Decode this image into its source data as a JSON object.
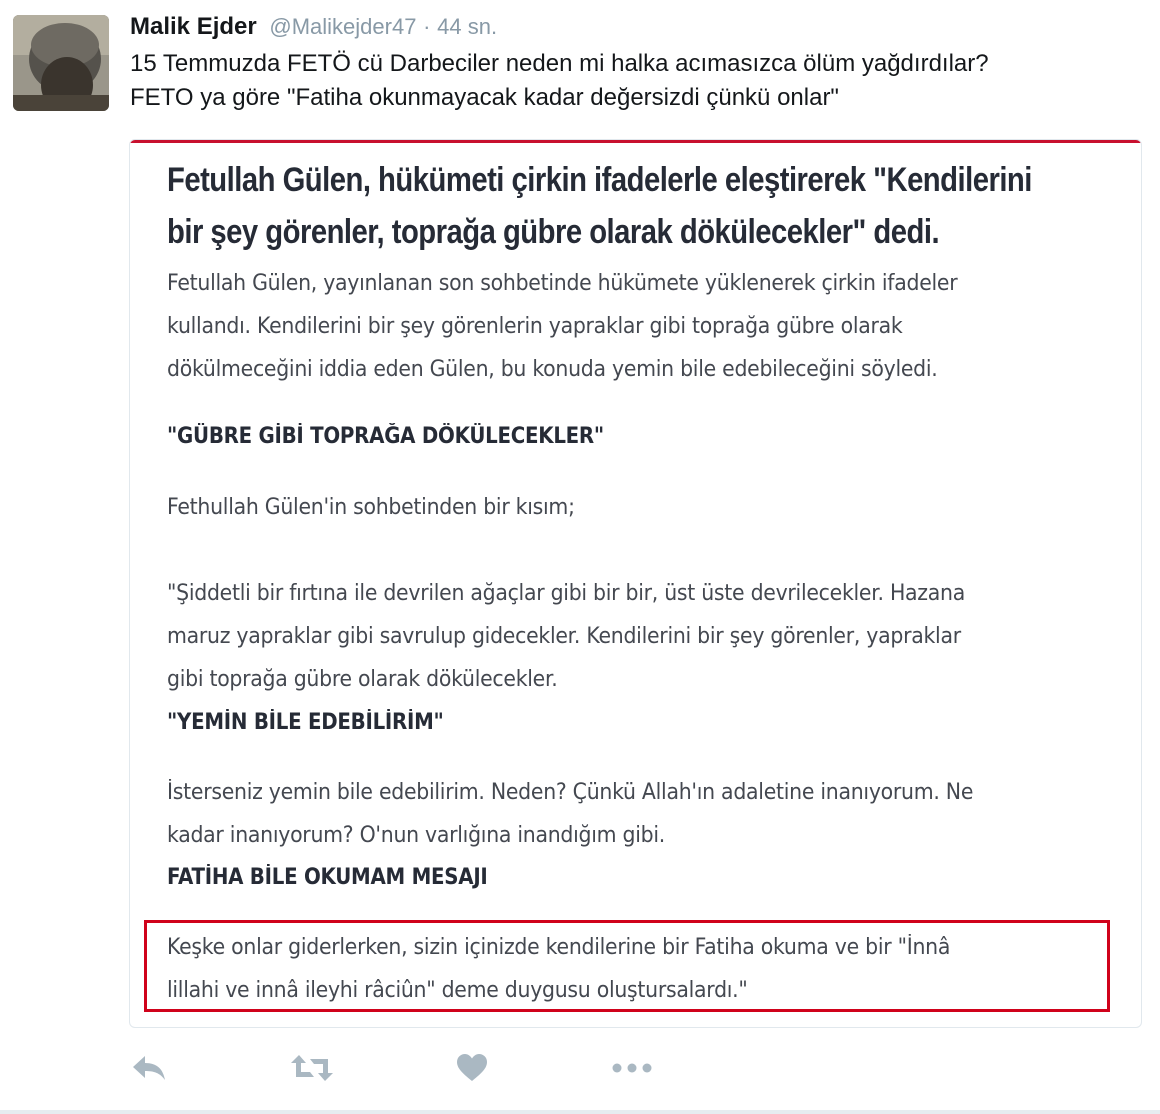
{
  "tweet": {
    "author_name": "Malik Ejder",
    "author_handle": "@Malikejder47",
    "separator": "·",
    "timestamp": "44 sn.",
    "text_lines": [
      "15 Temmuzda FETÖ cü Darbeciler neden mi halka acımasızca ölüm yağdırdılar?",
      "FETO ya göre \"Fatiha okunmayacak kadar değersizdi çünkü onlar\""
    ]
  },
  "article": {
    "headline_lines": [
      "Fetullah Gülen, hükümeti çirkin ifadelerle eleştirerek \"Kendilerini",
      "bir şey görenler, toprağa gübre olarak dökülecekler\" dedi."
    ],
    "intro_lines": [
      "Fetullah Gülen, yayınlanan son sohbetinde hükümete yüklenerek çirkin ifadeler",
      "kullandı. Kendilerini bir şey görenlerin yapraklar gibi toprağa gübre olarak",
      "dökülmeceğini iddia eden Gülen, bu konuda yemin bile edebileceğini söyledi."
    ],
    "subhead_1": "\"GÜBRE GİBİ TOPRAĞA DÖKÜLECEKLER\"",
    "excerpt_intro": "Fethullah Gülen'in sohbetinden bir kısım;",
    "quote_lines": [
      "\"Şiddetli bir fırtına ile devrilen ağaçlar gibi bir bir, üst üste devrilecekler. Hazana",
      "maruz yapraklar gibi savrulup gidecekler. Kendilerini bir şey görenler, yapraklar",
      "gibi toprağa gübre olarak dökülecekler."
    ],
    "subhead_2": "\"YEMİN BİLE EDEBİLİRİM\"",
    "oath_lines": [
      "İsterseniz yemin bile edebilirim. Neden? Çünkü Allah'ın adaletine inanıyorum. Ne",
      "kadar inanıyorum? O'nun varlığına inandığım gibi."
    ],
    "subhead_3": "FATİHA BİLE OKUMAM MESAJI",
    "highlight_lines": [
      "Keşke onlar giderlerken, sizin içinizde kendilerine bir Fatiha okuma ve bir \"İnnâ",
      "lillahi ve innâ ileyhi râciûn\" deme duygusu oluştursalardı.\""
    ]
  },
  "actions": {
    "reply_icon": "reply-icon",
    "retweet_icon": "retweet-icon",
    "like_icon": "heart-icon",
    "more_icon": "more-icon"
  },
  "colors": {
    "icon_gray": "#aab8c2",
    "highlight_red": "#d0021b",
    "article_accent": "#c8102e"
  }
}
